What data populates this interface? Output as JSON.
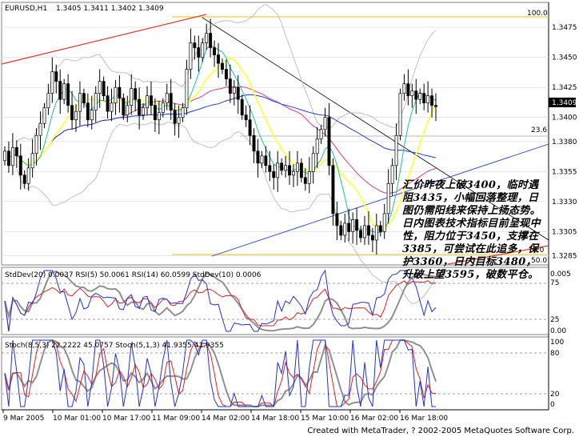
{
  "chart_data": [
    {
      "type": "candlestick",
      "title": "EURUSD,H1",
      "ohlc_header": "1.3405 1.3411 1.3402 1.3409",
      "current_price_label": "1.3409",
      "ylim": [
        1.3278,
        1.3495
      ],
      "y_ticks": [
        "1.3475",
        "1.3450",
        "1.3425",
        "1.3400",
        "1.3380",
        "1.3355",
        "1.3330",
        "1.3305",
        "1.3285"
      ],
      "fib_labels": [
        "100.0",
        "23.6",
        "0.0",
        "50.0"
      ],
      "closes": [
        1.3372,
        1.336,
        1.3375,
        1.3368,
        1.3352,
        1.3345,
        1.3358,
        1.337,
        1.3385,
        1.3395,
        1.3408,
        1.342,
        1.3438,
        1.343,
        1.3415,
        1.3428,
        1.341,
        1.3398,
        1.3405,
        1.342,
        1.3412,
        1.3398,
        1.3406,
        1.342,
        1.343,
        1.3418,
        1.3405,
        1.3412,
        1.3425,
        1.3416,
        1.3402,
        1.341,
        1.3424,
        1.3415,
        1.3402,
        1.3408,
        1.3418,
        1.341,
        1.3398,
        1.3404,
        1.3412,
        1.342,
        1.3406,
        1.3395,
        1.34,
        1.3408,
        1.344,
        1.3462,
        1.3458,
        1.345,
        1.3462,
        1.347,
        1.3458,
        1.3452,
        1.3445,
        1.344,
        1.3432,
        1.342,
        1.3425,
        1.3415,
        1.3402,
        1.3398,
        1.3385,
        1.3372,
        1.3362,
        1.3368,
        1.336,
        1.3355,
        1.335,
        1.3362,
        1.3356,
        1.336,
        1.3352,
        1.3355,
        1.3362,
        1.335,
        1.3345,
        1.3355,
        1.337,
        1.3382,
        1.339,
        1.34,
        1.336,
        1.332,
        1.331,
        1.3302,
        1.3312,
        1.3305,
        1.3315,
        1.3306,
        1.33,
        1.331,
        1.3302,
        1.3298,
        1.331,
        1.3305,
        1.332,
        1.3345,
        1.336,
        1.3385,
        1.342,
        1.3428,
        1.3418,
        1.3422,
        1.3415,
        1.342,
        1.3412,
        1.3418,
        1.341,
        1.3409
      ],
      "series": [
        {
          "name": "",
          "color": "#c0c0c0"
        },
        {
          "name": "",
          "color": "#d23c8c"
        },
        {
          "name": "",
          "color": "#2040c8"
        },
        {
          "name": "",
          "color": "#ffff33"
        },
        {
          "name": "",
          "color": "#20c0a0"
        }
      ]
    },
    {
      "type": "line",
      "label": "StdDev(20) 0.0037  RSI(5) 50.0061  RSI(14) 60.0599  StdDev(10) 0.0006",
      "y_ticks": [
        "0.005",
        "75",
        "25",
        "0.00"
      ],
      "series": [
        {
          "name": "RSI(5)",
          "color": "#2233cc"
        },
        {
          "name": "RSI(14)",
          "color": "#dd2222"
        },
        {
          "name": "StdDev(20)",
          "color": "#909090"
        }
      ]
    },
    {
      "type": "line",
      "label": "Stoch(8,5,3) 22.2222 45.0757  Stoch(5,1,3) 41.9355 41.9355",
      "y_ticks": [
        "100",
        "80",
        "20",
        "0"
      ],
      "series": [
        {
          "name": "Stoch(5,1,3)",
          "color": "#2233cc"
        },
        {
          "name": "Stoch(8,5,3)",
          "color": "#dd2222"
        },
        {
          "name": "Stoch signal",
          "color": "#909090"
        }
      ]
    }
  ],
  "x_labels": [
    "9 Mar 2005",
    "10 Mar 01:00",
    "10 Mar 17:00",
    "11 Mar 09:00",
    "14 Mar 02:00",
    "14 Mar 18:00",
    "15 Mar 10:00",
    "16 Mar 02:00",
    "16 Mar 18:00"
  ],
  "annotation_text": "汇价昨夜上破3400，临时遇阻3435，小幅回落整理，日图仍需阳线来保持上扬态势。日内图表技术指标目前呈现中性，阻力位于3450，支撑在3385，可尝试在此追多，保护3360，日内目标3480，升破上望3595，破数平仓。",
  "footer_text": "Created with MetaTrader, ? 2002-2005 MetaQuotes Software Corp."
}
